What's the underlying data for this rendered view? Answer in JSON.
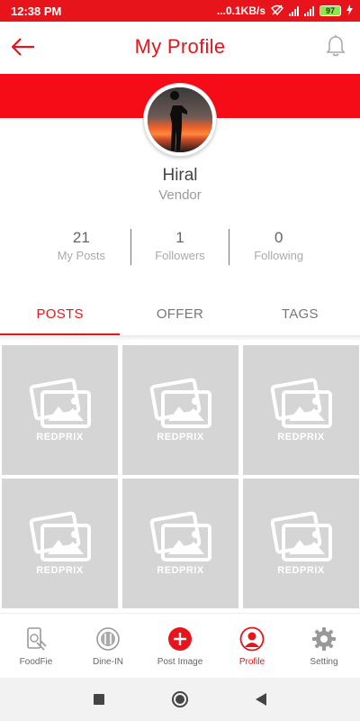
{
  "status": {
    "time": "12:38 PM",
    "speed": "...0.1KB/s",
    "battery": "97"
  },
  "header": {
    "title": "My Profile"
  },
  "profile": {
    "name": "Hiral",
    "role": "Vendor"
  },
  "stats": [
    {
      "value": "21",
      "label": "My Posts"
    },
    {
      "value": "1",
      "label": "Followers"
    },
    {
      "value": "0",
      "label": "Following"
    }
  ],
  "tabs": [
    {
      "label": "POSTS",
      "active": true
    },
    {
      "label": "OFFER",
      "active": false
    },
    {
      "label": "TAGS",
      "active": false
    }
  ],
  "grid": {
    "placeholder_text": [
      "REDPRIX",
      "REDPRIX",
      "REDPRIX",
      "REDPRIX",
      "REDPRIX",
      "REDPRIX"
    ]
  },
  "bottom_nav": [
    {
      "label": "FoodFie",
      "icon": "foodfie-icon"
    },
    {
      "label": "Dine-IN",
      "icon": "dine-in-icon"
    },
    {
      "label": "Post Image",
      "icon": "plus-circle-icon"
    },
    {
      "label": "Profile",
      "icon": "profile-icon",
      "active": true
    },
    {
      "label": "Setting",
      "icon": "gear-icon"
    }
  ],
  "colors": {
    "brand_red": "#e8141b",
    "placeholder_gray": "#d5d5d5"
  }
}
